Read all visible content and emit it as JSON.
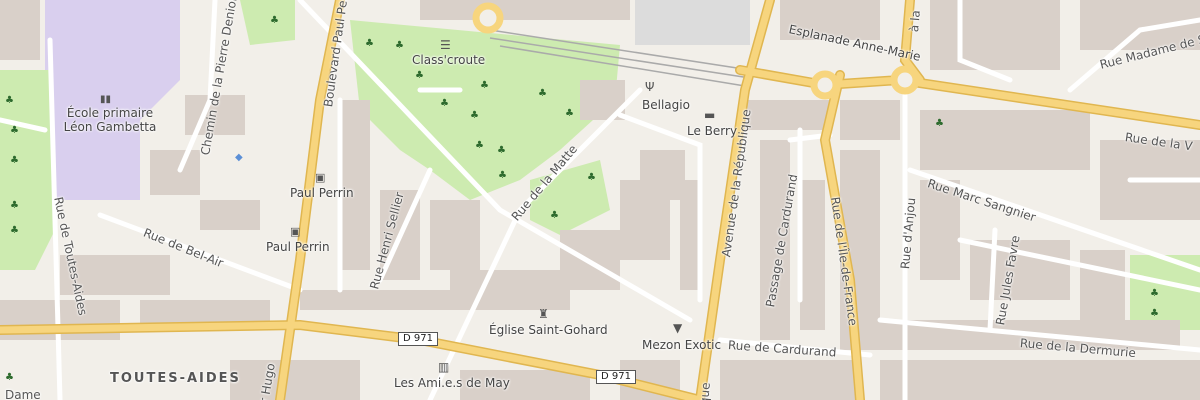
{
  "map": {
    "district": "TOUTES-AIDES",
    "road_refs": [
      "D 971",
      "D 971"
    ],
    "pois": {
      "school": "École primaire\nLéon Gambetta",
      "snack": "Class'croute",
      "bellagio": "Bellagio",
      "hotel": "Le Berry",
      "bus1": "Paul Perrin",
      "bus2": "Paul Perrin",
      "church": "Église Saint-Gohard",
      "shop": "Mezon Exotic",
      "assoc": "Les Ami.e.s de May",
      "esplanade": "Esplanade Anne-Marie"
    },
    "streets": {
      "pierre_deniol": "Chemin de la Pierre Deniol",
      "boulevard_paul_perrin": "Boulevard Paul Perrin",
      "toutes_aides": "Rue de Toutes-Aides",
      "bel_air": "Rue de Bel-Air",
      "henri_sellier": "Rue Henri Sellier",
      "matte": "Rue de la Matte",
      "republique": "Avenue de la République",
      "passage_cardurand": "Passage de Cardurand",
      "ile_de_france": "Rue de l'Île-de-France",
      "anjou": "Rue d'Anjou",
      "marc_sangnier": "Rue Marc Sangnier",
      "jules_favre": "Rue Jules Favre",
      "dermurie": "Rue de la Dermurie",
      "cardurand": "Rue de Cardurand",
      "madame": "Rue Madame de S",
      "la_v": "Rue de la V",
      "dame": "Dame",
      "hugo": "r Hugo",
      "top_right_partial": "à la",
      "bottom_partial": "que"
    },
    "icons": {
      "park": "tree-icon",
      "bus": "bus-stop-icon",
      "school": "school-icon",
      "restaurant": "fork-knife-icon",
      "snack": "fast-food-icon",
      "hotel": "bed-icon",
      "church": "church-icon",
      "shop": "shopping-basket-icon",
      "museum": "institution-icon"
    },
    "colors": {
      "background": "#f2efe9",
      "building": "#d9d0c9",
      "major_road": "#f7d57e",
      "major_road_casing": "#e0b650",
      "minor_road": "#ffffff",
      "park": "#cdebb0",
      "school_area": "#d9cfee",
      "rail": "#aaaaaa"
    }
  }
}
